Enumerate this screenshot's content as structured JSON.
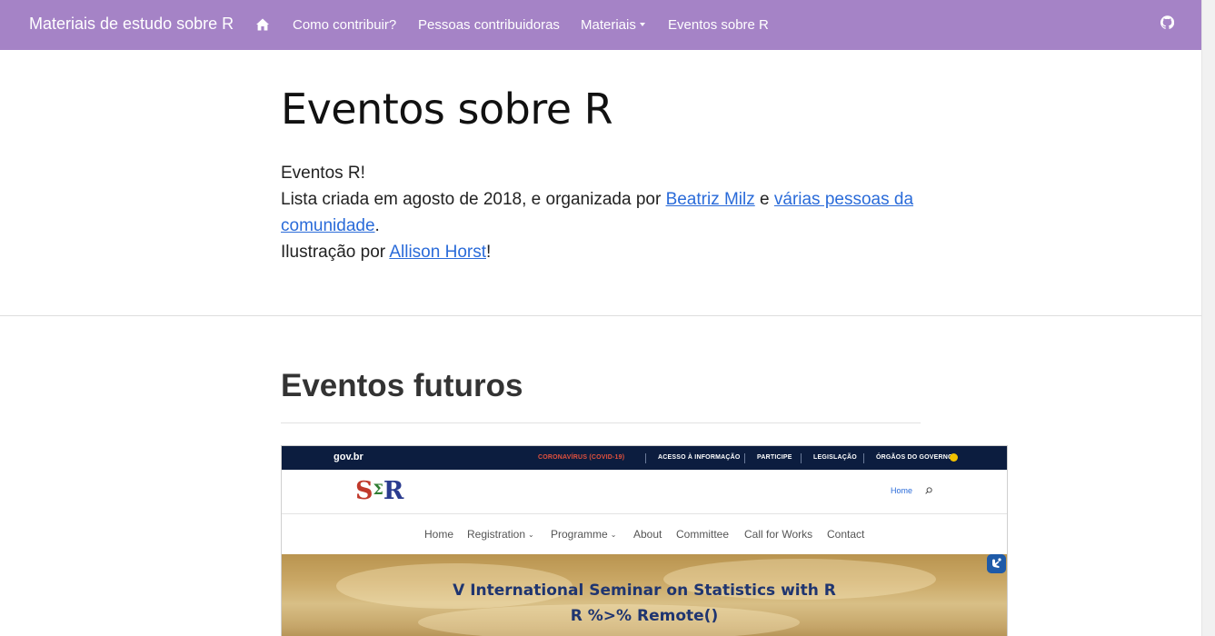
{
  "navbar": {
    "brand": "Materiais de estudo sobre R",
    "items": [
      {
        "label": "Como contribuir?"
      },
      {
        "label": "Pessoas contribuidoras"
      },
      {
        "label": "Materiais"
      },
      {
        "label": "Eventos sobre R"
      }
    ],
    "icons": {
      "home": "home-icon",
      "github": "github-icon"
    }
  },
  "header": {
    "title": "Eventos sobre R",
    "line1": "Eventos R!",
    "line2_prefix": "Lista criada em agosto de 2018, e organizada por ",
    "link_beatriz": "Beatriz Milz",
    "line2_mid": " e ",
    "link_community": "várias pessoas da comunidade",
    "line2_end": ".",
    "line3_prefix": "Ilustração por ",
    "link_allison": "Allison Horst",
    "line3_end": "!"
  },
  "section": {
    "title": "Eventos futuros"
  },
  "embedded_screenshot": {
    "gov_logo": "gov.br",
    "gov_links": [
      "CORONAVÍRUS (COVID-19)",
      "ACESSO À INFORMAÇÃO",
      "PARTICIPE",
      "LEGISLAÇÃO",
      "ÓRGÃOS DO GOVERNO"
    ],
    "logo_s": "S",
    "logo_sigma": "Σ",
    "logo_r": "R",
    "header_home": "Home",
    "nav": [
      {
        "label": "Home",
        "chevron": ""
      },
      {
        "label": "Registration",
        "chevron": "⌄"
      },
      {
        "label": "Programme",
        "chevron": "⌄"
      },
      {
        "label": "About",
        "chevron": ""
      },
      {
        "label": "Committee",
        "chevron": ""
      },
      {
        "label": "Call for Works",
        "chevron": ""
      },
      {
        "label": "Contact",
        "chevron": ""
      }
    ],
    "hero_line1": "V International Seminar on Statistics with R",
    "hero_line2": "R %>% Remote()"
  },
  "colors": {
    "navbar_bg": "#a583c6",
    "link": "#2a6bd9",
    "gov_bar": "#0c1d3f",
    "hero_text": "#1f3570"
  }
}
